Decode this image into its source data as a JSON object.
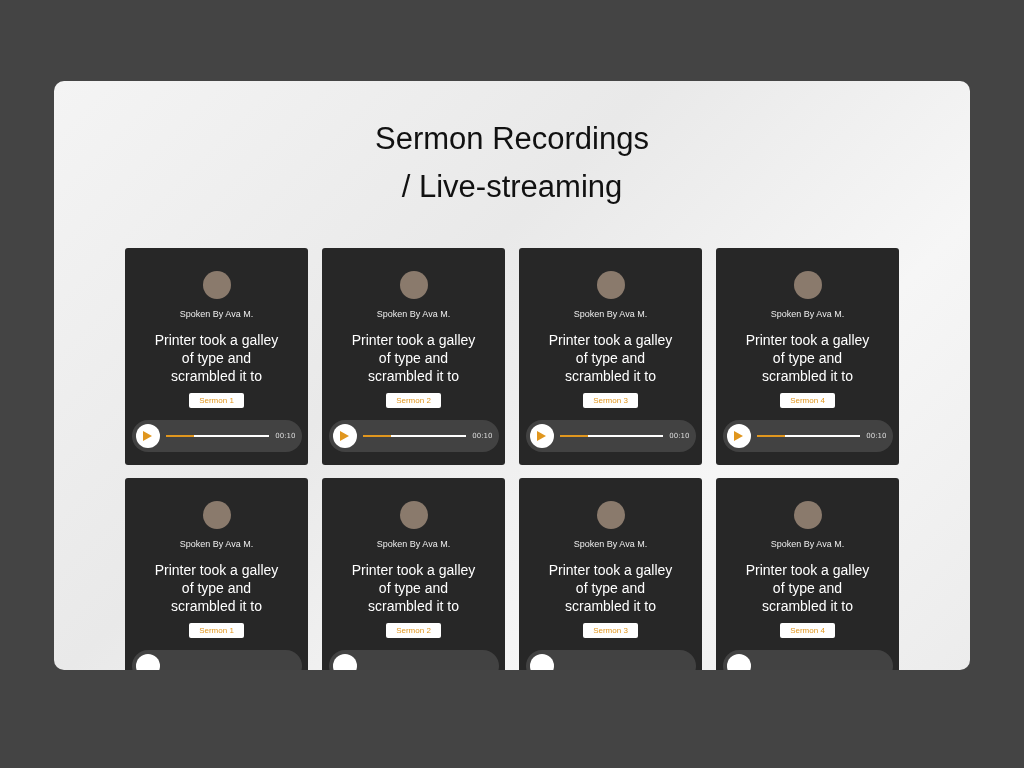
{
  "title_lines": [
    "Sermon Recordings",
    "/ Live-streaming"
  ],
  "cards": [
    {
      "speaker": "Spoken By Ava M.",
      "headline": "Printer took a galley of type and scrambled it to",
      "tag": "Sermon 1",
      "player": {
        "level": 0.27,
        "time": "00:10"
      }
    },
    {
      "speaker": "Spoken By Ava M.",
      "headline": "Printer took a galley of type and scrambled it to",
      "tag": "Sermon 2",
      "player": {
        "level": 0.27,
        "time": "00:10"
      }
    },
    {
      "speaker": "Spoken By Ava M.",
      "headline": "Printer took a galley of type and scrambled it to",
      "tag": "Sermon 3",
      "player": {
        "level": 0.27,
        "time": "00:10"
      }
    },
    {
      "speaker": "Spoken By Ava M.",
      "headline": "Printer took a galley of type and scrambled it to",
      "tag": "Sermon 4",
      "player": {
        "level": 0.27,
        "time": "00:10"
      }
    },
    {
      "speaker": "Spoken By Ava M.",
      "headline": "Printer took a galley of type and scrambled it to",
      "tag": "Sermon 1"
    },
    {
      "speaker": "Spoken By Ava M.",
      "headline": "Printer took a galley of type and scrambled it to",
      "tag": "Sermon 2"
    },
    {
      "speaker": "Spoken By Ava M.",
      "headline": "Printer took a galley of type and scrambled it to",
      "tag": "Sermon 3"
    },
    {
      "speaker": "Spoken By Ava M.",
      "headline": "Printer took a galley of type and scrambled it to",
      "tag": "Sermon 4"
    }
  ]
}
